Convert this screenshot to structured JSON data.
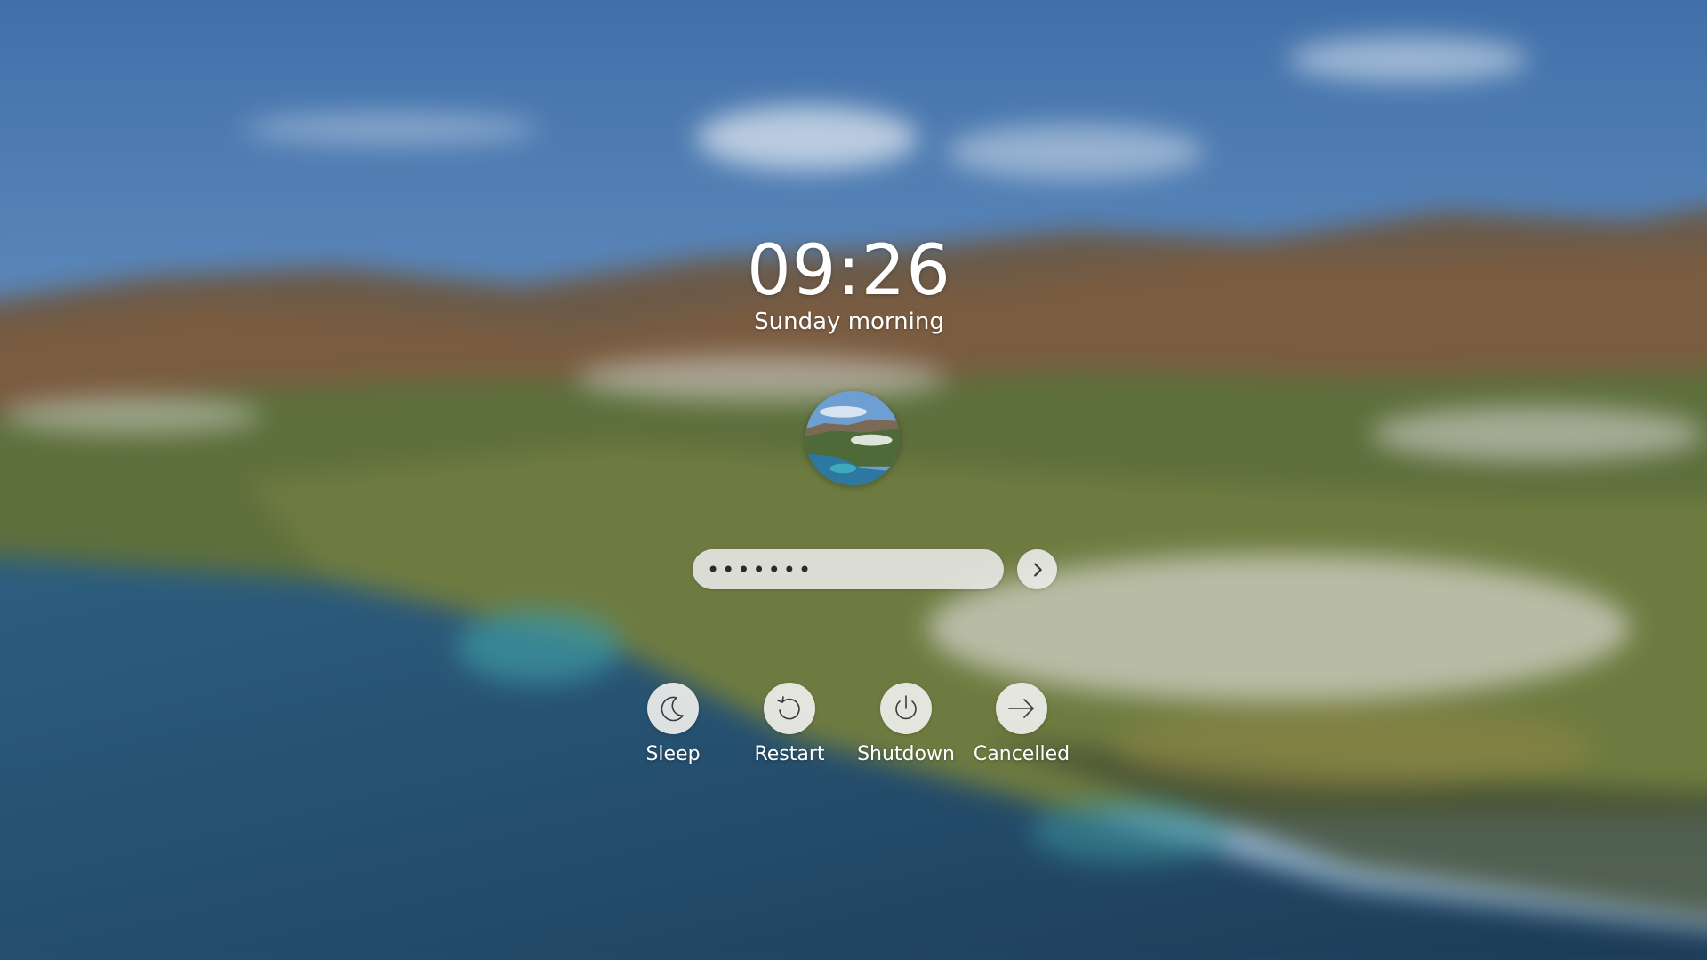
{
  "clock": {
    "time": "09:26",
    "greeting": "Sunday morning"
  },
  "user": {
    "avatar_icon": "user-avatar-landscape"
  },
  "login": {
    "password_value": "●●●●●●●",
    "submit_icon": "chevron-right-icon"
  },
  "actions": [
    {
      "label": "Sleep",
      "icon": "moon-icon"
    },
    {
      "label": "Restart",
      "icon": "restart-icon"
    },
    {
      "label": "Shutdown",
      "icon": "power-icon"
    },
    {
      "label": "Cancelled",
      "icon": "arrow-right-icon"
    }
  ],
  "colors": {
    "text": "#ffffff",
    "button_bg": "#eeeeec",
    "icon": "#3a3a3a"
  }
}
